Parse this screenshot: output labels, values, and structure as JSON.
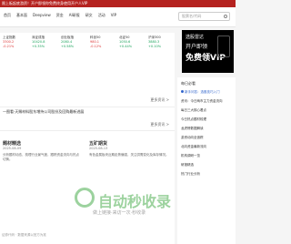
{
  "banner": "限上板起底游资！开户即领你免费终身使用开户人VIP",
  "nav": [
    "首页",
    "基本面",
    "Deepview",
    "资金",
    "AI研报",
    "研文",
    "活动",
    "VIP"
  ],
  "search": {
    "placeholder": "股票名/代码"
  },
  "stats": [
    {
      "label": "上证指数",
      "value": "3300.2",
      "change": "-0.21%"
    },
    {
      "label": "深证成指",
      "value": "10420.8",
      "change": "+0.35%"
    },
    {
      "label": "创业板指",
      "value": "2080.4",
      "change": "+0.58%"
    },
    {
      "label": "科创50",
      "value": "980.1",
      "change": "-0.12%"
    },
    {
      "label": "北证50",
      "value": "1050.6",
      "change": "+0.44%"
    },
    {
      "label": "沪深300",
      "value": "3880.3",
      "change": "+0.10%"
    }
  ],
  "promo": {
    "line1": "选股雷达",
    "line2": "开户即领",
    "line3": "免费领VIP"
  },
  "section1": {
    "more": "更多资讯 >"
  },
  "headline": "一图看·天赐材料股东增持公司股份及回购最新进展",
  "section2": {
    "more": "更多资讯 >"
  },
  "cards": [
    {
      "title": "题材精选",
      "date": "2025-08-09",
      "desc": "分析题材动态，梳理行业景气度，跟踪资金流向与热点切换。"
    },
    {
      "title": "五矿期货",
      "date": "2025-08-13",
      "desc": "有色金属板块近期走势偏强，关注供需变化及库存情况。"
    }
  ],
  "sidebar": {
    "title": "每日必看",
    "items": [
      "新手问答：选股技巧入门",
      "资讯：今日两市主力资金流向",
      "每日三大核心看点",
      "今日热点题材梳理",
      "龙虎榜数据解读",
      "游资动向全追踪",
      "北向资金最新流向",
      "机构调研一览",
      "研报精选",
      "热门行业分析"
    ]
  },
  "footer": "证券代码 · 数据来源以官方为准",
  "watermark": {
    "big": "自动秒收录",
    "small": "做上链接·来访一次·秒收录"
  }
}
